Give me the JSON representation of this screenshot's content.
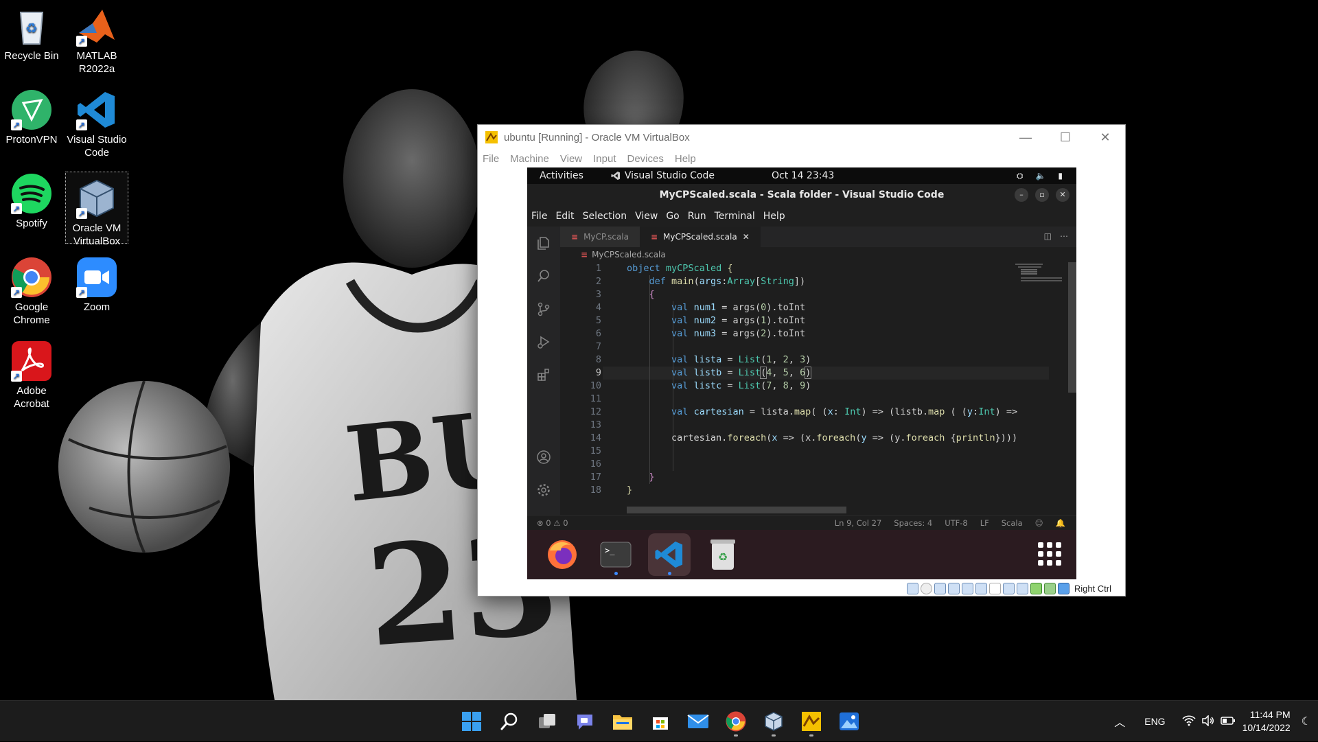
{
  "desktop": {
    "icons": [
      {
        "label": "Recycle Bin"
      },
      {
        "label": "MATLAB R2022a"
      },
      {
        "label": "ProtonVPN"
      },
      {
        "label": "Visual Studio Code"
      },
      {
        "label": "Spotify"
      },
      {
        "label": "Oracle VM VirtualBox"
      },
      {
        "label": "Google Chrome"
      },
      {
        "label": "Zoom"
      },
      {
        "label": "Adobe Acrobat"
      }
    ]
  },
  "vbox": {
    "title": "ubuntu [Running] - Oracle VM VirtualBox",
    "menu": [
      "File",
      "Machine",
      "View",
      "Input",
      "Devices",
      "Help"
    ],
    "host_key": "Right Ctrl"
  },
  "gnome": {
    "activities": "Activities",
    "app_name": "Visual Studio Code",
    "clock": "Oct 14  23:43"
  },
  "vscode": {
    "title": "MyCPScaled.scala - Scala folder - Visual Studio Code",
    "menu": [
      "File",
      "Edit",
      "Selection",
      "View",
      "Go",
      "Run",
      "Terminal",
      "Help"
    ],
    "tabs": [
      {
        "label": "MyCP.scala"
      },
      {
        "label": "MyCPScaled.scala"
      }
    ],
    "breadcrumb": "MyCPScaled.scala",
    "status": {
      "problems": "⊗ 0 ⚠ 0",
      "position": "Ln 9, Col 27",
      "spaces": "Spaces: 4",
      "encoding": "UTF-8",
      "eol": "LF",
      "language": "Scala"
    }
  },
  "taskbar": {
    "lang": "ENG",
    "time": "11:44 PM",
    "date": "10/14/2022"
  }
}
